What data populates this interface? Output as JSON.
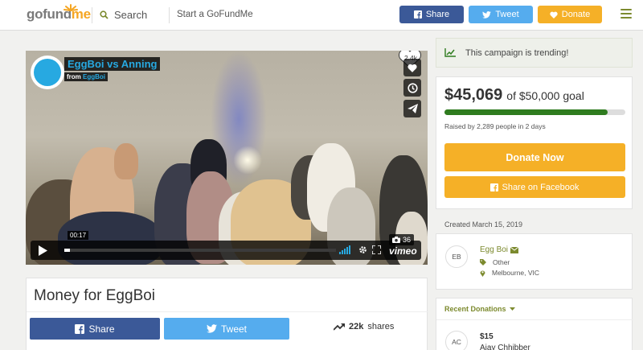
{
  "header": {
    "logo_text_a": "gofund",
    "logo_text_b": "me",
    "search_label": "Search",
    "start_label": "Start a GoFundMe",
    "share_label": "Share",
    "tweet_label": "Tweet",
    "donate_label": "Donate"
  },
  "video": {
    "title": "EggBoi vs Anning",
    "from_label": "from",
    "from_user": "EggBoi",
    "likes": "2.4k",
    "timestamp": "00:17",
    "photo_count": "36",
    "brand": "vimeo",
    "progress_fraction": 0.02
  },
  "campaign": {
    "title": "Money for EggBoi",
    "share_label": "Share",
    "tweet_label": "Tweet",
    "shares_count": "22k",
    "shares_label": "shares"
  },
  "sidebar": {
    "trending_text": "This campaign is trending!",
    "raised_amount": "$45,069",
    "goal_text": "of $50,000 goal",
    "progress_fraction": 0.9014,
    "raised_by": "Raised by 2,289 people in 2 days",
    "donate_now": "Donate Now",
    "share_facebook": "Share on Facebook",
    "created": "Created March 15, 2019",
    "organizer": {
      "initials": "EB",
      "name": "Egg Boi",
      "category": "Other",
      "location": "Melbourne, VIC"
    },
    "recent_heading": "Recent Donations",
    "donation": {
      "initials": "AC",
      "amount": "$15",
      "name": "Ajay Chhibber"
    }
  },
  "colors": {
    "facebook": "#3b5998",
    "twitter": "#55acee",
    "donate": "#f5b027",
    "progress": "#2f7c1f",
    "brand_green": "#7c8a2e",
    "vimeo_blue": "#27a9e1"
  }
}
